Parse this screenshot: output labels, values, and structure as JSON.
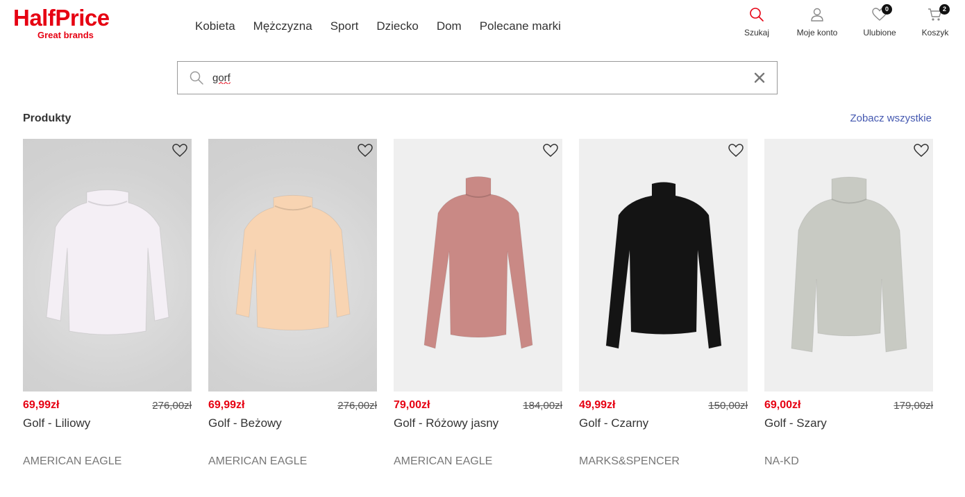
{
  "header": {
    "logo_brand": "HalfPrice",
    "logo_tagline": "Great brands",
    "nav": [
      "Kobieta",
      "Mężczyzna",
      "Sport",
      "Dziecko",
      "Dom",
      "Polecane marki"
    ],
    "actions": {
      "search": {
        "label": "Szukaj",
        "icon": "search-icon"
      },
      "account": {
        "label": "Moje konto",
        "icon": "user-icon"
      },
      "favorites": {
        "label": "Ulubione",
        "icon": "heart-icon",
        "count": "0"
      },
      "cart": {
        "label": "Koszyk",
        "icon": "cart-icon",
        "count": "2"
      }
    }
  },
  "search": {
    "value": "gorf",
    "placeholder": ""
  },
  "section": {
    "title": "Produkty",
    "see_all": "Zobacz wszystkie"
  },
  "products": [
    {
      "price": "69,99zł",
      "old_price": "276,00zł",
      "name": "Golf - Liliowy",
      "brand": "AMERICAN EAGLE",
      "color": "#f4eff5",
      "bg": "#d6d6d6"
    },
    {
      "price": "69,99zł",
      "old_price": "276,00zł",
      "name": "Golf - Beżowy",
      "brand": "AMERICAN EAGLE",
      "color": "#f8d4b2",
      "bg": "#d6d6d6"
    },
    {
      "price": "79,00zł",
      "old_price": "184,00zł",
      "name": "Golf - Różowy jasny",
      "brand": "AMERICAN EAGLE",
      "color": "#c98985",
      "bg": "#efefef"
    },
    {
      "price": "49,99zł",
      "old_price": "150,00zł",
      "name": "Golf - Czarny",
      "brand": "MARKS&SPENCER",
      "color": "#141414",
      "bg": "#efefef"
    },
    {
      "price": "69,00zł",
      "old_price": "179,00zł",
      "name": "Golf - Szary",
      "brand": "NA-KD",
      "color": "#c8cac3",
      "bg": "#efefef"
    }
  ],
  "colors": {
    "accent": "#e60012",
    "link": "#4458b0"
  }
}
